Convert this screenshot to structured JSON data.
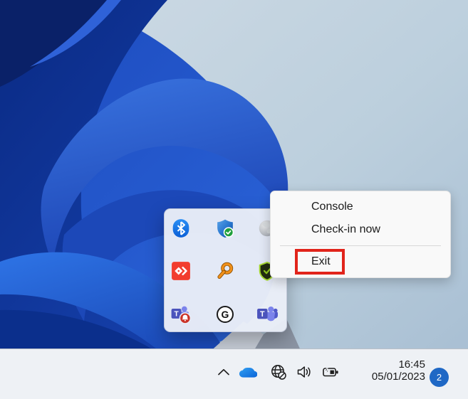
{
  "desktop": {
    "wallpaper": "windows-11-bloom",
    "bg_top_color": "#cfdbe5",
    "bg_bottom_color": "#a6bdd2",
    "bloom_blue": "#1f4cc0"
  },
  "context_menu": {
    "items": [
      {
        "label": "Console"
      },
      {
        "label": "Check-in now"
      },
      {
        "label": "Exit",
        "highlighted": true
      }
    ],
    "highlight_box_color": "#e1241b"
  },
  "tray_flyout": {
    "icons": [
      {
        "name": "bluetooth-icon"
      },
      {
        "name": "windows-security-shield-icon"
      },
      {
        "name": "gray-globe-icon"
      },
      {
        "name": "red-diamond-chevron-icon"
      },
      {
        "name": "orange-magnifier-icon"
      },
      {
        "name": "dark-green-shield-icon"
      },
      {
        "name": "teams-notification-bell-icon",
        "letter": "T"
      },
      {
        "name": "g-circle-icon",
        "letter": "G"
      },
      {
        "name": "teams-icon",
        "letter": "T"
      }
    ]
  },
  "taskbar": {
    "tray_icons": [
      {
        "name": "chevron-up-icon"
      },
      {
        "name": "onedrive-cloud-icon"
      },
      {
        "name": "network-globe-offline-icon"
      },
      {
        "name": "volume-speaker-icon"
      },
      {
        "name": "battery-charging-icon"
      }
    ],
    "clock": {
      "time": "16:45",
      "date": "05/01/2023"
    },
    "notification_badge": {
      "count": "2",
      "color": "#1f68c5"
    }
  }
}
